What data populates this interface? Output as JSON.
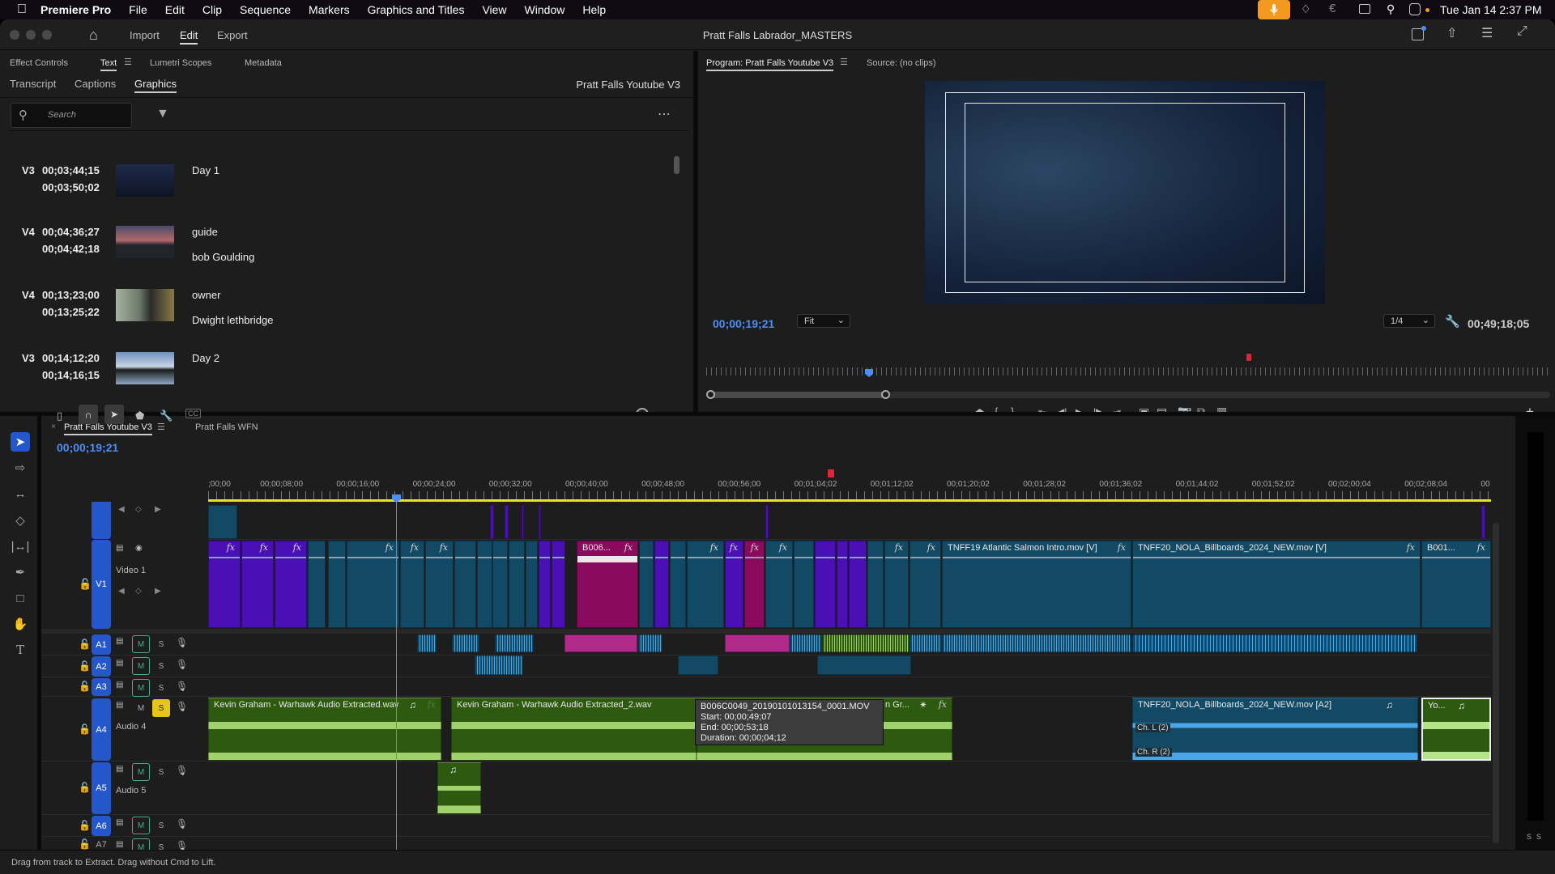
{
  "menubar": {
    "app_name": "Premiere Pro",
    "items": [
      "File",
      "Edit",
      "Clip",
      "Sequence",
      "Markers",
      "Graphics and Titles",
      "View",
      "Window",
      "Help"
    ],
    "clock": "Tue Jan 14  2:37 PM",
    "status_icons": [
      "microphone-icon",
      "flame-icon",
      "euro-icon",
      "window-icon",
      "search-icon",
      "control-center-icon"
    ]
  },
  "titlebar": {
    "project_title": "Pratt Falls Labrador_MASTERS",
    "nav_tabs": [
      {
        "label": "Import"
      },
      {
        "label": "Edit",
        "active": true
      },
      {
        "label": "Export"
      }
    ]
  },
  "left_panel": {
    "tabs_row1": [
      {
        "label": "Effect Controls"
      },
      {
        "label": "Text",
        "active": true
      },
      {
        "label": "Lumetri Scopes"
      },
      {
        "label": "Metadata"
      }
    ],
    "tabs_row2": [
      {
        "label": "Transcript"
      },
      {
        "label": "Captions"
      },
      {
        "label": "Graphics",
        "active": true
      }
    ],
    "sequence_name": "Pratt Falls Youtube V3",
    "search_placeholder": "Search",
    "graphics": [
      {
        "track": "V3",
        "in": "00;03;44;15",
        "out": "00;03;50;02",
        "lines": [
          "Day 1"
        ],
        "thumb": "night-boat"
      },
      {
        "track": "V4",
        "in": "00;04;36;27",
        "out": "00;04;42;18",
        "lines": [
          "guide",
          "bob Goulding"
        ],
        "thumb": "sunset-guide"
      },
      {
        "track": "V4",
        "in": "00;13;23;00",
        "out": "00;13;25;22",
        "lines": [
          "owner",
          "Dwight lethbridge"
        ],
        "thumb": "owner-portrait"
      },
      {
        "track": "V3",
        "in": "00;14;12;20",
        "out": "00;14;16;15",
        "lines": [
          "Day 2"
        ],
        "thumb": "river-sky"
      }
    ]
  },
  "program_monitor": {
    "tab_label": "Program: Pratt Falls Youtube V3",
    "source_label": "Source: (no clips)",
    "current_timecode": "00;00;19;21",
    "zoom_select": "Fit",
    "resolution_select": "1/4",
    "duration_timecode": "00;49;18;05",
    "transport_buttons": [
      "add-marker",
      "mark-in",
      "mark-out",
      "go-to-in",
      "step-back",
      "play",
      "step-forward",
      "go-to-out",
      "lift",
      "extract",
      "export-frame",
      "comparison-view",
      "toggle-proxies",
      "add-button"
    ]
  },
  "timeline": {
    "tabs": [
      {
        "label": "Pratt Falls Youtube V3",
        "active": true
      },
      {
        "label": "Pratt Falls WFN"
      }
    ],
    "current_timecode": "00;00;19;21",
    "ruler_labels": [
      ";00;00",
      "00;00;08;00",
      "00;00;16;00",
      "00;00;24;00",
      "00;00;32;00",
      "00;00;40;00",
      "00;00;48;00",
      "00;00;56;00",
      "00;01;04;02",
      "00;01;12;02",
      "00;01;20;02",
      "00;01;28;02",
      "00;01;36;02",
      "00;01;44;02",
      "00;01;52;02",
      "00;02;00;04",
      "00;02;08;04",
      "00"
    ],
    "tracks": {
      "V1": {
        "label": "V1",
        "name": "Video 1"
      },
      "A1": {
        "label": "A1"
      },
      "A2": {
        "label": "A2"
      },
      "A3": {
        "label": "A3"
      },
      "A4": {
        "label": "A4",
        "name": "Audio 4",
        "solo": true
      },
      "A5": {
        "label": "A5",
        "name": "Audio 5"
      },
      "A6": {
        "label": "A6"
      },
      "A7": {
        "label": "A7"
      }
    },
    "mute_label": "M",
    "solo_label": "S",
    "clips": {
      "v1_b006": "B006...",
      "v1_tnff19": "TNFF19 Atlantic Salmon Intro.mov [V]",
      "v1_tnff20": "TNFF20_NOLA_Billboards_2024_NEW.mov [V]",
      "v1_b001": "B001...",
      "a4_kevin1": "Kevin Graham - Warhawk Audio Extracted.wav",
      "a4_kevin2": "Kevin Graham - Warhawk Audio Extracted_2.wav",
      "a4_kevin3": "n Gr...",
      "a4_tnff20": "TNFF20_NOLA_Billboards_2024_NEW.mov [A2]",
      "a4_yo": "Yo...",
      "ch_l": "Ch. L (2)",
      "ch_r": "Ch. R (2)",
      "fx": "fx"
    },
    "tooltip": {
      "name": "B006C0049_20190101013154_0001.MOV",
      "start": "Start: 00;00;49;07",
      "end": "End: 00;00;53;18",
      "duration": "Duration: 00;00;04;12"
    },
    "meter_labels": [
      "S",
      "S"
    ]
  },
  "status_bar": {
    "text": "Drag from track to Extract. Drag without Cmd to Lift."
  },
  "colors": {
    "accent_blue": "#2457c9",
    "timecode_blue": "#4b8ef5",
    "mic_orange": "#f39a1e",
    "solo_yellow": "#e6c619",
    "mute_green": "#3fb383",
    "playhead_red": "#e0253b"
  }
}
